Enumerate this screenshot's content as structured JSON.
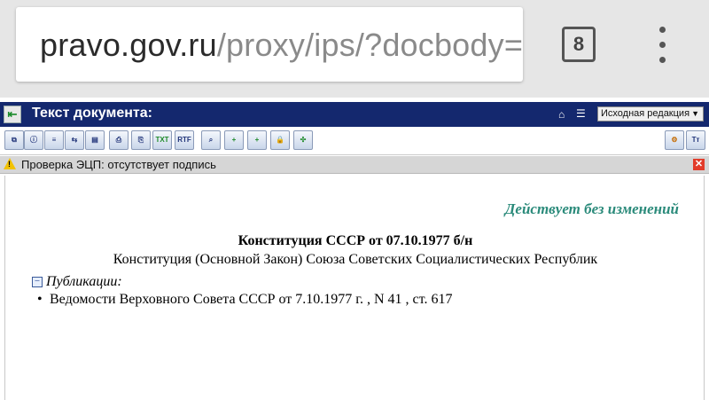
{
  "browser": {
    "url_domain": "pravo.gov.ru",
    "url_path": "/proxy/ips/?docbody=",
    "tab_count": "8"
  },
  "header": {
    "back_icon": "back-arrow-icon",
    "title": "Текст документа:",
    "edition_select": {
      "selected": "Исходная редакция",
      "arrow": "▼"
    }
  },
  "toolbar": {
    "buttons": [
      {
        "icon": "copy-icon",
        "glyph": "⧉"
      },
      {
        "icon": "info-icon",
        "glyph": "ⓘ"
      },
      {
        "icon": "doc-list-icon",
        "glyph": "≡"
      },
      {
        "icon": "doc-link-icon",
        "glyph": "⇆"
      },
      {
        "icon": "doc-view-icon",
        "glyph": "▤"
      },
      {
        "icon": "print-icon",
        "glyph": "⎙"
      },
      {
        "icon": "print-preview-icon",
        "glyph": "⎘"
      },
      {
        "icon": "save-txt-icon",
        "glyph": "TXT"
      },
      {
        "icon": "save-rtf-icon",
        "glyph": "RTF"
      },
      {
        "icon": "search-icon",
        "glyph": "⌕"
      },
      {
        "icon": "add-bookmark-icon",
        "glyph": "+"
      },
      {
        "icon": "add-note-icon",
        "glyph": "+"
      },
      {
        "icon": "lock-icon",
        "glyph": "🔒"
      },
      {
        "icon": "tree-icon",
        "glyph": "✣"
      },
      {
        "icon": "settings-icon",
        "glyph": "⚙"
      },
      {
        "icon": "font-size-icon",
        "glyph": "Tт"
      }
    ]
  },
  "warning": {
    "text": "Проверка ЭЦП: отсутствует подпись",
    "close": "✕"
  },
  "document": {
    "status": "Действует без изменений",
    "title": "Конституция СССР от 07.10.1977 б/н",
    "subtitle": "Конституция (Основной Закон) Союза Советских Социалистических Республик",
    "publications_label": "Публикации:",
    "publications": [
      "Ведомости Верховного Совета СССР от 7.10.1977 г. , N 41 , ст. 617"
    ]
  }
}
